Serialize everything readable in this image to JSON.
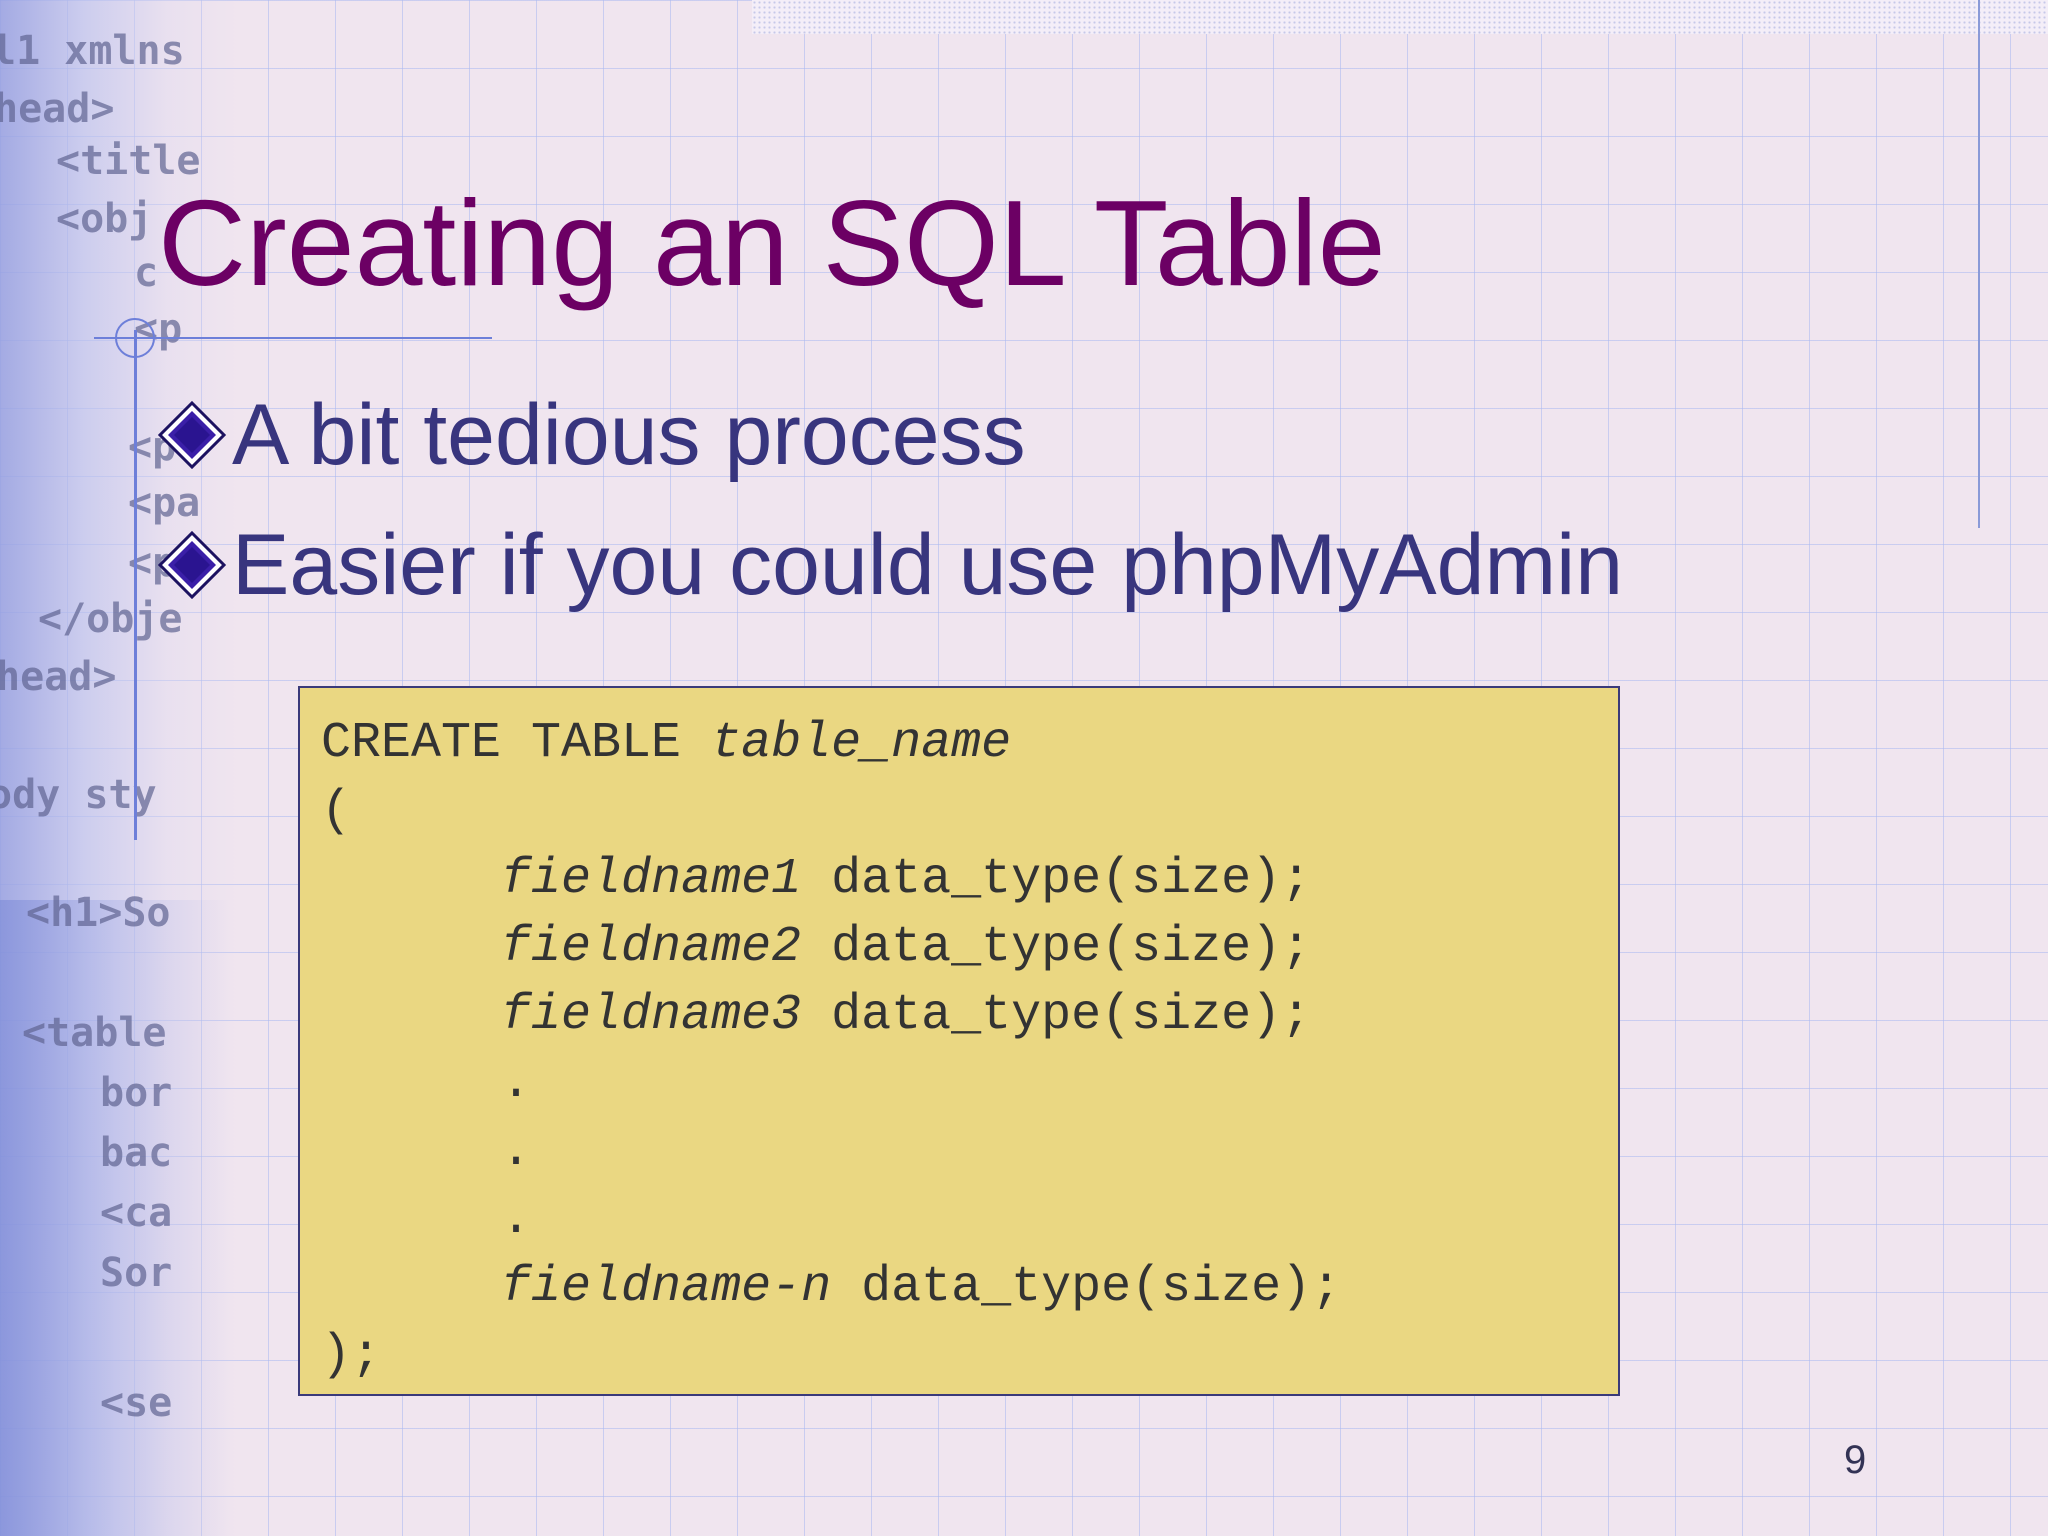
{
  "slide": {
    "title": "Creating an SQL Table",
    "bullets": [
      {
        "text": "A bit tedious process"
      },
      {
        "text": "Easier if you could use phpMyAdmin"
      }
    ],
    "code_block": {
      "lines": [
        {
          "plain": "CREATE TABLE ",
          "italic": "table_name",
          "suffix": ""
        },
        {
          "plain": "(",
          "italic": "",
          "suffix": ""
        },
        {
          "plain": "      ",
          "italic": "fieldname1",
          "suffix": " data_type(size);"
        },
        {
          "plain": "      ",
          "italic": "fieldname2",
          "suffix": " data_type(size);"
        },
        {
          "plain": "      ",
          "italic": "fieldname3",
          "suffix": " data_type(size);"
        },
        {
          "plain": "      .",
          "italic": "",
          "suffix": ""
        },
        {
          "plain": "      .",
          "italic": "",
          "suffix": ""
        },
        {
          "plain": "      .",
          "italic": "",
          "suffix": ""
        },
        {
          "plain": "      ",
          "italic": "fieldname-n",
          "suffix": " data_type(size);"
        },
        {
          "plain": ");",
          "italic": "",
          "suffix": ""
        }
      ]
    },
    "page_number": "9",
    "background_code_fragments": [
      "l1 xmlns",
      "head>",
      "<title",
      "<obj",
      "c",
      "<p",
      "<p",
      "<pa",
      "<p",
      "</obje",
      "head>",
      "ody sty",
      "<h1>So",
      "<table",
      "bor",
      "bac",
      "<ca",
      "Sor",
      "<se"
    ],
    "colors": {
      "title": "#6c0064",
      "bullet_text": "#38357e",
      "code_background": "#ead782",
      "background": "#f0e5ef",
      "bullet_diamond": "#3b1fa8"
    },
    "icons": {
      "bullet": "diamond-bullet-icon"
    }
  }
}
